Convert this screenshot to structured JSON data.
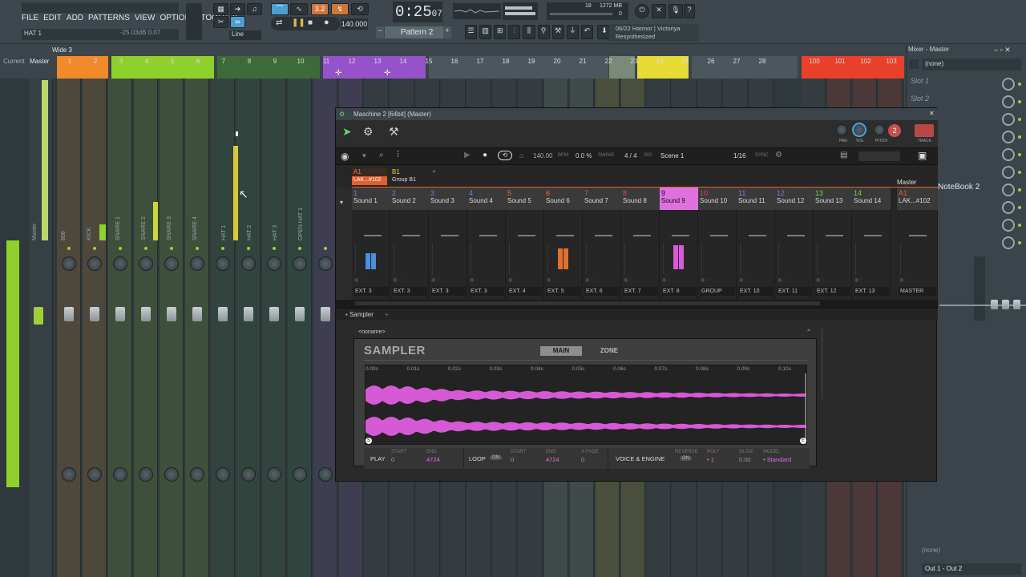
{
  "menu": [
    "FILE",
    "EDIT",
    "ADD",
    "PATTERNS",
    "VIEW",
    "OPTIONS",
    "TOOLS",
    "?"
  ],
  "hint": {
    "name": "HAT 1",
    "value": "-25.03dB  0.07"
  },
  "transport": {
    "time": "0:25",
    "time_sub": "07",
    "tempo": "140.000",
    "pattern": "Pattern 2"
  },
  "cpu": {
    "voices": "18",
    "mem": "1272 MB",
    "cpu_val": "0"
  },
  "song_info": {
    "line1": "06/22  Harmor | Victoriya",
    "line2": "Resynthesized"
  },
  "mixer": {
    "title": "Wide 3",
    "header_left": "Current",
    "header_master": "Master",
    "track_numbers": [
      "1",
      "2",
      "3",
      "4",
      "5",
      "6",
      "7",
      "8",
      "9",
      "10",
      "11",
      "12",
      "13",
      "14",
      "15",
      "16",
      "17",
      "18",
      "19",
      "20",
      "21",
      "22",
      "23",
      "24",
      "25",
      "26",
      "27",
      "28",
      "100",
      "101",
      "102",
      "103"
    ],
    "strip_labels": [
      "Master",
      "808",
      "KICK",
      "SNARE 1",
      "SNARE 2",
      "SNARE 3",
      "SNARE 4",
      "HAT 1",
      "HAT 2",
      "HAT 3",
      "OPEN HAT 1"
    ],
    "colors": {
      "orange": "#f08a2a",
      "green": "#8ed12d",
      "darkgreen": "#3c6a3a",
      "purple": "#9552c9",
      "gray": "#4c575d",
      "sage": "#7a8a78",
      "yellow": "#e6da35",
      "red": "#e8402a"
    }
  },
  "right_panel": {
    "title": "Mixer - Master",
    "preset": "(none)",
    "slots": [
      "Slot 1",
      "Slot 2",
      "",
      "",
      "",
      "",
      "NoteBook 2",
      "",
      "",
      ""
    ],
    "bottom_none": "(none)",
    "output": "Out 1 - Out 2"
  },
  "maschine": {
    "title": "Maschine 2 [64bit] (Master)",
    "bpm": "140.00",
    "bpm_label": "BPM",
    "swing": "0.0 %",
    "swing_label": "SWING",
    "sig": "4 / 4",
    "sig_label": "SIG",
    "scene": "Scene 1",
    "grid": "1/16",
    "sync_label": "SYNC",
    "knob_labels": [
      "PAN",
      "VOL",
      "PITCH",
      "TRACK"
    ],
    "group_a": "A1",
    "group_a_name": "LAK...#102",
    "group_b": "B1",
    "group_b_name": "Group B1",
    "master": "Master",
    "channels": [
      {
        "num": "1",
        "name": "Sound 1",
        "out": "EXT. 3",
        "color": "#4a8fdd"
      },
      {
        "num": "2",
        "name": "Sound 2",
        "out": "EXT. 3",
        "color": "#4a8fdd"
      },
      {
        "num": "3",
        "name": "Sound 3",
        "out": "EXT. 3",
        "color": "#4a8fdd"
      },
      {
        "num": "4",
        "name": "Sound 4",
        "out": "EXT. 3",
        "color": "#4a8fdd"
      },
      {
        "num": "5",
        "name": "Sound 5",
        "out": "EXT. 4",
        "color": "#e0702a"
      },
      {
        "num": "6",
        "name": "Sound 6",
        "out": "EXT. 5",
        "color": "#e0702a"
      },
      {
        "num": "7",
        "name": "Sound 7",
        "out": "EXT. 6",
        "color": "#e04a3a"
      },
      {
        "num": "8",
        "name": "Sound 8",
        "out": "EXT. 7",
        "color": "#e04a3a"
      },
      {
        "num": "9",
        "name": "Sound 9",
        "out": "EXT. 8",
        "color": "#e070e0"
      },
      {
        "num": "10",
        "name": "Sound 10",
        "out": "GROUP",
        "color": "#e04a3a"
      },
      {
        "num": "11",
        "name": "Sound 11",
        "out": "EXT. 10",
        "color": "#9a6ad8"
      },
      {
        "num": "12",
        "name": "Sound 12",
        "out": "EXT. 11",
        "color": "#9a6ad8"
      },
      {
        "num": "13",
        "name": "Sound 13",
        "out": "EXT. 12",
        "color": "#6ed24a"
      },
      {
        "num": "14",
        "name": "Sound 14",
        "out": "EXT. 13",
        "color": "#6ed24a"
      },
      {
        "num": "A1",
        "name": "LAK...#102",
        "out": "MASTER",
        "color": "#e06030"
      }
    ],
    "tab": "Sampler",
    "sampler": {
      "noname": "<noname>",
      "title": "SAMPLER",
      "tabs": [
        "MAIN",
        "ZONE"
      ],
      "ruler": [
        "0.00s",
        "0.01s",
        "0.02s",
        "0.03s",
        "0.04s",
        "0.05s",
        "0.06s",
        "0.07s",
        "0.08s",
        "0.09s",
        "0.10s"
      ],
      "play_label": "PLAY",
      "loop_label": "LOOP",
      "voice_label": "VOICE & ENGINE",
      "start_label": "START",
      "end_label": "END",
      "xfade_label": "X-FADE",
      "reverse_label": "REVERSE",
      "poly_label": "POLY",
      "glide_label": "GLIDE",
      "model_label": "MODEL",
      "play_start": "0",
      "play_end": "4724",
      "loop_state": "ON",
      "loop_start": "0",
      "loop_end": "4724",
      "xfade": "0",
      "reverse": "ON",
      "poly": "1",
      "glide": "0.00",
      "model": "Standard"
    }
  }
}
